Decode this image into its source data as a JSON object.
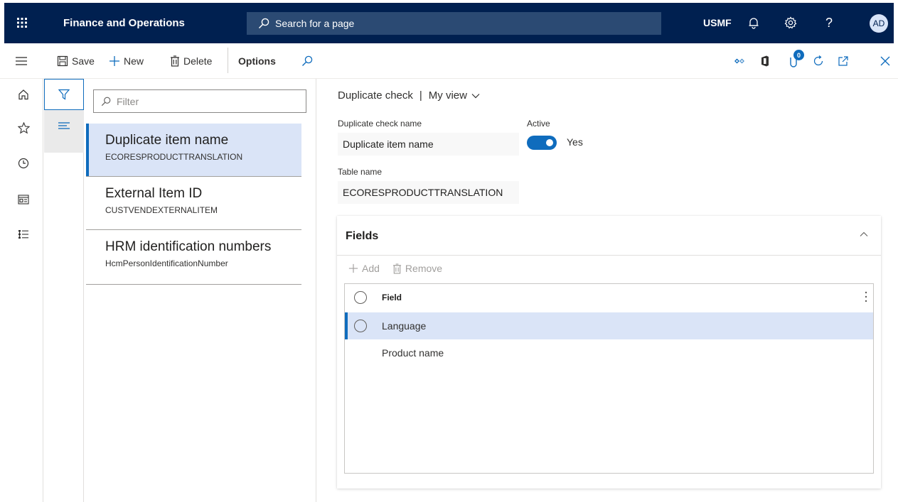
{
  "topbar": {
    "app_title": "Finance and Operations",
    "search_label": "Search for a page",
    "company": "USMF",
    "avatar_initials": "AD",
    "help_glyph": "?",
    "bg_color": "#002050"
  },
  "actionpane": {
    "save_label": "Save",
    "new_label": "New",
    "delete_label": "Delete",
    "options_label": "Options",
    "attachments_count": "0"
  },
  "list": {
    "filter_placeholder": "Filter",
    "items": [
      {
        "title": "Duplicate item name",
        "subtitle": "ECORESPRODUCTTRANSLATION"
      },
      {
        "title": "External Item ID",
        "subtitle": "CUSTVENDEXTERNALITEM"
      },
      {
        "title": "HRM identification numbers",
        "subtitle": "HcmPersonIdentificationNumber"
      }
    ]
  },
  "details": {
    "caption_form": "Duplicate check",
    "caption_divider": "|",
    "caption_view": "My view",
    "name_label": "Duplicate check name",
    "name_value": "Duplicate item name",
    "active_label": "Active",
    "active_value": "Yes",
    "table_label": "Table name",
    "table_value": "ECORESPRODUCTTRANSLATION"
  },
  "fields_card": {
    "title": "Fields",
    "add_label": "Add",
    "remove_label": "Remove",
    "column_header": "Field",
    "rows": [
      "Language",
      "Product name"
    ]
  },
  "icons": [
    "waffle-icon",
    "search-icon",
    "bell-icon",
    "gear-icon",
    "help-icon",
    "hamburger-icon",
    "save-icon",
    "plus-icon",
    "delete-icon",
    "diamond-icon",
    "office-icon",
    "attachment-icon",
    "refresh-icon",
    "open-new-window-icon",
    "close-icon",
    "home-icon",
    "star-icon",
    "clock-icon",
    "workspace-icon",
    "modules-icon",
    "filter-icon",
    "list-icon",
    "chevron-down-icon",
    "chevron-up-icon",
    "more-vertical-icon"
  ],
  "colors": {
    "accent": "#0f6cbd",
    "selection": "#dae4f7",
    "navbar": "#002050"
  }
}
